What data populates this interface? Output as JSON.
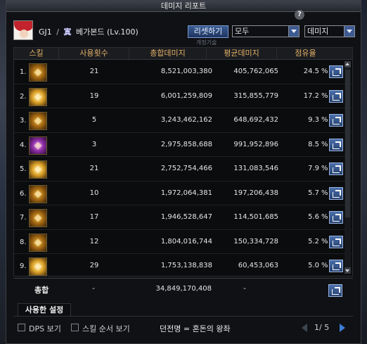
{
  "window": {
    "title": "데미지 리포트"
  },
  "character": {
    "guild": "GJ1",
    "separator": "/",
    "guild_mark": "寘",
    "name": "베가본드 (Lv.100)"
  },
  "controls": {
    "reset_label": "리셋하기",
    "reset_hint": "개정기술",
    "range_value": "모두",
    "type_value": "데미지"
  },
  "table": {
    "headers": {
      "skill": "스킬",
      "use_count": "사용횟수",
      "total_damage": "총합데미지",
      "avg_damage": "평균데미지",
      "share": "점유율"
    },
    "rows": [
      {
        "rank": "1.",
        "use_count": "21",
        "total": "8,521,003,380",
        "avg": "405,762,065",
        "share": "24.5",
        "pct": "%"
      },
      {
        "rank": "2.",
        "use_count": "19",
        "total": "6,001,259,809",
        "avg": "315,855,779",
        "share": "17.2",
        "pct": "%"
      },
      {
        "rank": "3.",
        "use_count": "5",
        "total": "3,243,462,162",
        "avg": "648,692,432",
        "share": "9.3",
        "pct": "%"
      },
      {
        "rank": "4.",
        "use_count": "3",
        "total": "2,975,858,688",
        "avg": "991,952,896",
        "share": "8.5",
        "pct": "%"
      },
      {
        "rank": "5.",
        "use_count": "21",
        "total": "2,752,754,466",
        "avg": "131,083,546",
        "share": "7.9",
        "pct": "%"
      },
      {
        "rank": "6.",
        "use_count": "10",
        "total": "1,972,064,381",
        "avg": "197,206,438",
        "share": "5.7",
        "pct": "%"
      },
      {
        "rank": "7.",
        "use_count": "17",
        "total": "1,946,528,647",
        "avg": "114,501,685",
        "share": "5.6",
        "pct": "%"
      },
      {
        "rank": "8.",
        "use_count": "12",
        "total": "1,804,016,744",
        "avg": "150,334,728",
        "share": "5.2",
        "pct": "%"
      },
      {
        "rank": "9.",
        "use_count": "29",
        "total": "1,753,138,838",
        "avg": "60,453,063",
        "share": "5.0",
        "pct": "%"
      }
    ],
    "summary": {
      "label": "총합",
      "use_count": "-",
      "total": "34,849,170,408",
      "avg": "-"
    }
  },
  "tabs": {
    "used_settings": "사용한 설정"
  },
  "footer": {
    "dps_label": "DPS 보기",
    "skill_order_label": "스킬 순서 보기",
    "dungeon": "던전명 = 혼돈의 왕좌",
    "page": "1/ 5"
  }
}
